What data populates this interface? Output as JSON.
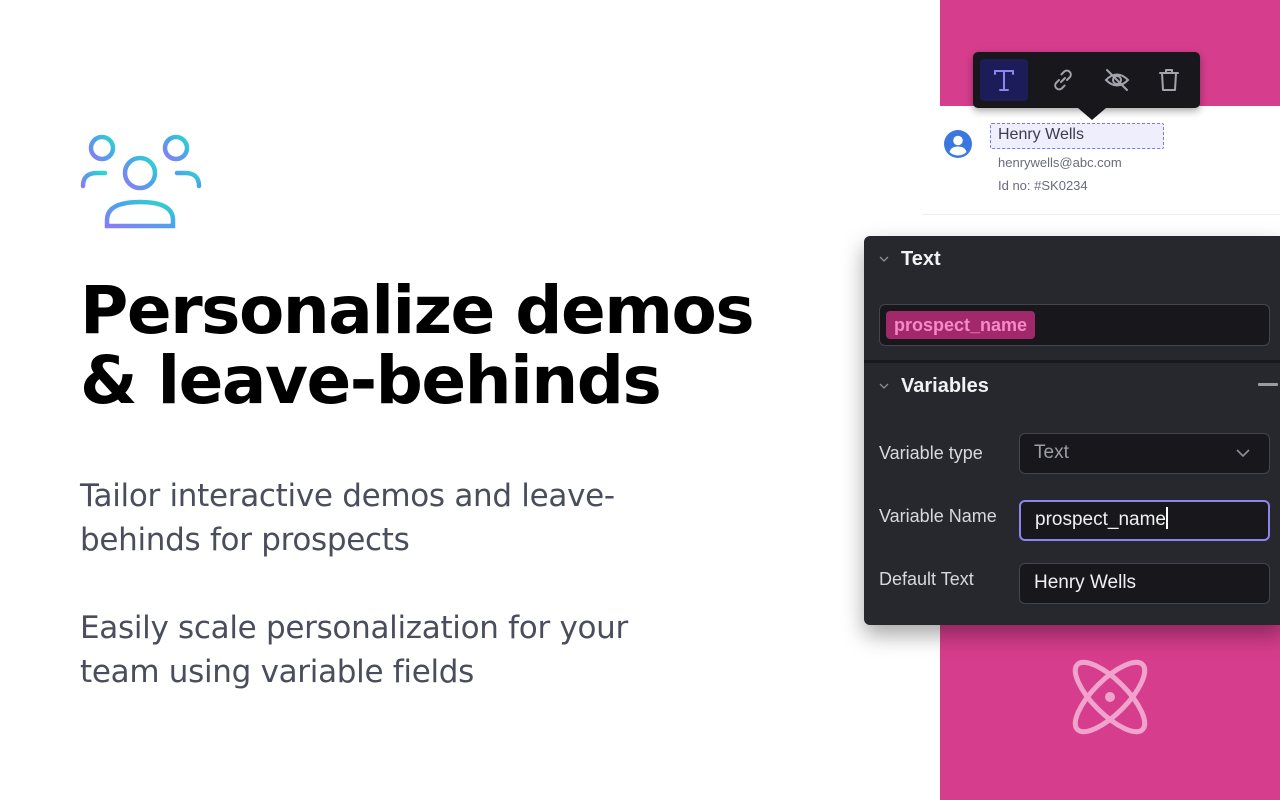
{
  "hero": {
    "icon": "users-group-icon",
    "title_line1": "Personalize demos",
    "title_line2": "& leave-behinds",
    "description_1_line1": "Tailor interactive demos and leave-",
    "description_1_line2": "behinds for prospects",
    "description_2_line1": "Easily scale personalization for your",
    "description_2_line2": "team using variable fields"
  },
  "toolbar": {
    "buttons": [
      {
        "icon": "text-type-icon",
        "active": true
      },
      {
        "icon": "link-icon",
        "active": false
      },
      {
        "icon": "eye-off-icon",
        "active": false
      },
      {
        "icon": "trash-icon",
        "active": false
      }
    ]
  },
  "profile": {
    "name": "Henry Wells",
    "email": "henrywells@abc.com",
    "id": "Id no: #SK0234"
  },
  "panel": {
    "text_section": {
      "title": "Text",
      "chip": "prospect_name"
    },
    "variables_section": {
      "title": "Variables",
      "fields": {
        "type_label": "Variable type",
        "type_value": "Text",
        "name_label": "Variable Name",
        "name_value": "prospect_name",
        "default_label": "Default Text",
        "default_value": "Henry Wells"
      }
    }
  },
  "colors": {
    "accent_pink": "#d63d8c",
    "panel_dark": "#27282e",
    "chip_bg": "#a2286c",
    "focus_border": "#8a86ee"
  }
}
